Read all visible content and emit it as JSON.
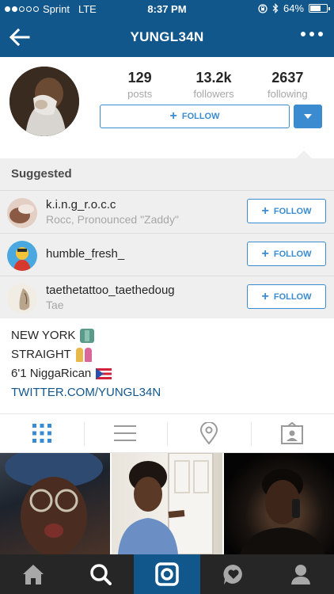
{
  "status_bar": {
    "carrier": "Sprint",
    "network": "LTE",
    "time": "8:37 PM",
    "battery": "64%",
    "battery_level": 0.64
  },
  "nav": {
    "title": "YUNGL34N",
    "back_icon": "back-arrow-icon",
    "more_icon": "more-dots-icon"
  },
  "profile": {
    "stats": [
      {
        "value": "129",
        "label": "posts"
      },
      {
        "value": "13.2k",
        "label": "followers"
      },
      {
        "value": "2637",
        "label": "following"
      }
    ],
    "follow_label": "FOLLOW"
  },
  "suggested": {
    "title": "Suggested",
    "items": [
      {
        "username": "k.i.n.g_r.o.c.c",
        "subtitle": "Rocc, Pronounced \"Zaddy\"",
        "button": "FOLLOW"
      },
      {
        "username": "humble_fresh_",
        "subtitle": "",
        "button": "FOLLOW"
      },
      {
        "username": "taethetattoo_taethedoug",
        "subtitle": "Tae",
        "button": "FOLLOW"
      }
    ]
  },
  "bio": {
    "lines": [
      "NEW YORK",
      "STRAIGHT",
      "6'1 NiggaRican"
    ],
    "link": "TWITTER.COM/YUNGL34N"
  },
  "tabs": [
    "grid-icon",
    "list-icon",
    "location-pin-icon",
    "tagged-photos-icon"
  ],
  "bottom_nav": [
    "home-icon",
    "search-icon",
    "camera-icon",
    "activity-heart-icon",
    "profile-icon"
  ],
  "colors": {
    "nav_blue": "#12578c",
    "follow_blue": "#3a8bd0",
    "active_tab": "#3a8bd0",
    "bottom_bar": "#262626"
  }
}
